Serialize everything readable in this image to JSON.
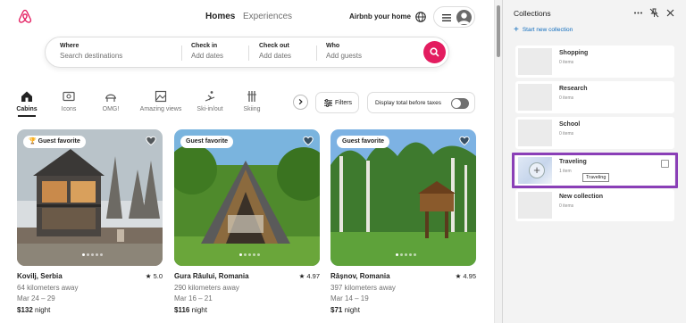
{
  "header": {
    "nav_homes": "Homes",
    "nav_experiences": "Experiences",
    "host_link": "Airbnb your home"
  },
  "search": {
    "where_label": "Where",
    "where_placeholder": "Search destinations",
    "checkin_label": "Check in",
    "checkin_placeholder": "Add dates",
    "checkout_label": "Check out",
    "checkout_placeholder": "Add dates",
    "who_label": "Who",
    "who_placeholder": "Add guests"
  },
  "categories": [
    {
      "label": "Cabins",
      "icon": "cabin-icon",
      "active": true
    },
    {
      "label": "Icons",
      "icon": "icons-icon"
    },
    {
      "label": "OMG!",
      "icon": "omg-house-icon"
    },
    {
      "label": "Amazing views",
      "icon": "amazing-views-icon"
    },
    {
      "label": "Ski-in/out",
      "icon": "ski-icon"
    },
    {
      "label": "Skiing",
      "icon": "skiing-icon"
    }
  ],
  "filters": {
    "filters_label": "Filters",
    "toggle_label": "Display total before taxes"
  },
  "listings": [
    {
      "badge": "Guest favorite",
      "location": "Kovilj, Serbia",
      "rating": "★ 5.0",
      "distance": "64 kilometers away",
      "dates": "Mar 24 – 29",
      "price": "$132",
      "price_unit": "night"
    },
    {
      "badge": "Guest favorite",
      "location": "Gura Râului, Romania",
      "rating": "★ 4.97",
      "distance": "290 kilometers away",
      "dates": "Mar 16 – 21",
      "price": "$116",
      "price_unit": "night"
    },
    {
      "badge": "Guest favorite",
      "location": "Râșnov, Romania",
      "rating": "★ 4.95",
      "distance": "397 kilometers away",
      "dates": "Mar 14 – 19",
      "price": "$71",
      "price_unit": "night"
    }
  ],
  "collections_panel": {
    "title": "Collections",
    "start_new": "Start new collection",
    "items": [
      {
        "name": "Shopping",
        "count": "0 items"
      },
      {
        "name": "Research",
        "count": "0 items"
      },
      {
        "name": "School",
        "count": "0 items"
      },
      {
        "name": "Traveling",
        "count": "1 item"
      },
      {
        "name": "New collection",
        "count": "0 items"
      }
    ],
    "tooltip": "Traveling"
  },
  "colors": {
    "brand": "#e31c5f",
    "highlight": "#8a3fb7",
    "link": "#0f6cbd"
  }
}
